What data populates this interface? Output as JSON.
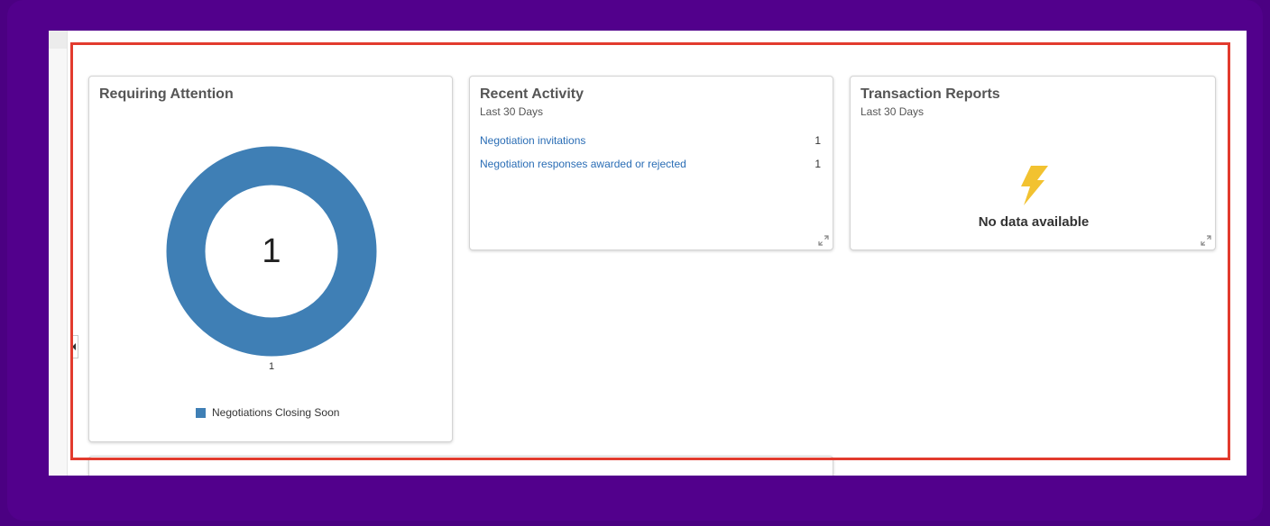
{
  "cards": {
    "requiring_attention": {
      "title": "Requiring Attention",
      "donut_center_value": "1",
      "donut_label": "1",
      "legend_label": "Negotiations Closing Soon",
      "legend_color": "#3f7fb5"
    },
    "recent_activity": {
      "title": "Recent Activity",
      "subtitle": "Last 30 Days",
      "items": [
        {
          "label": "Negotiation invitations",
          "count": "1"
        },
        {
          "label": "Negotiation responses awarded or rejected",
          "count": "1"
        }
      ]
    },
    "transaction_reports": {
      "title": "Transaction Reports",
      "subtitle": "Last 30 Days",
      "empty_message": "No data available",
      "empty_icon": "lightning-bolt-icon"
    }
  },
  "chart_data": {
    "type": "pie",
    "categories": [
      "Negotiations Closing Soon"
    ],
    "values": [
      1
    ],
    "title": "Requiring Attention",
    "legend": "bottom"
  },
  "colors": {
    "background": "#4b0082",
    "highlight_border": "#e23b2e",
    "donut": "#3f7fb5",
    "link": "#2a6db5",
    "bolt": "#f2c230"
  }
}
